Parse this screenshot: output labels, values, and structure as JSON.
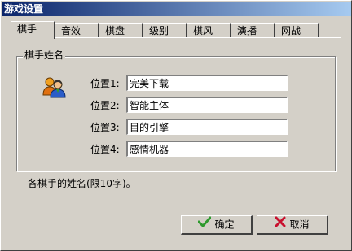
{
  "window": {
    "title": "游戏设置"
  },
  "tabs": [
    {
      "label": "棋手",
      "active": true
    },
    {
      "label": "音效",
      "active": false
    },
    {
      "label": "棋盘",
      "active": false
    },
    {
      "label": "级别",
      "active": false
    },
    {
      "label": "棋风",
      "active": false
    },
    {
      "label": "演播",
      "active": false
    },
    {
      "label": "网战",
      "active": false
    }
  ],
  "players": {
    "group_title": "棋手姓名",
    "icon": "users-icon",
    "rows": [
      {
        "label": "位置1:",
        "value": "完美下载"
      },
      {
        "label": "位置2:",
        "value": "智能主体"
      },
      {
        "label": "位置3:",
        "value": "目的引擎"
      },
      {
        "label": "位置4:",
        "value": "感情机器"
      }
    ],
    "hint": "各棋手的姓名(限10字)。"
  },
  "buttons": {
    "ok": {
      "label": "确定",
      "icon": "checkmark-icon",
      "icon_color": "#2e9a2e"
    },
    "cancel": {
      "label": "取消",
      "icon": "cross-icon",
      "icon_color": "#c8102e"
    }
  },
  "colors": {
    "title_gradient_start": "#0a246a",
    "title_gradient_end": "#a6caf0",
    "face": "#d4d0c8"
  }
}
